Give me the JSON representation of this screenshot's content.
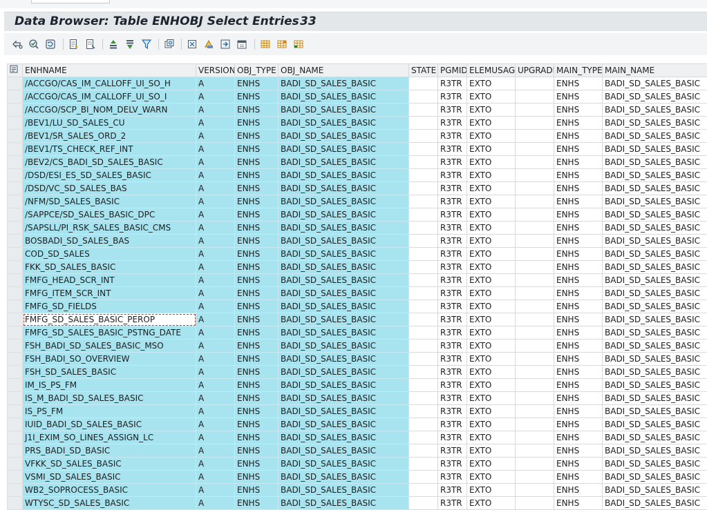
{
  "title": {
    "text": "Data Browser: Table ENHOBJ Select Entries",
    "count": "33"
  },
  "toolbar": {
    "buttons": [
      {
        "name": "display-icon"
      },
      {
        "name": "check-table-icon"
      },
      {
        "name": "refresh-icon"
      },
      {
        "name": "choose-detail-icon"
      },
      {
        "name": "print-icon"
      },
      {
        "name": "sort-ascending-icon"
      },
      {
        "name": "sort-descending-icon"
      },
      {
        "name": "filter-icon"
      },
      {
        "name": "total-icon"
      },
      {
        "name": "export-spreadsheet-icon"
      },
      {
        "name": "change-layout-icon"
      },
      {
        "name": "save-layout-icon"
      },
      {
        "name": "abc-analysis-icon"
      },
      {
        "name": "grid-view-icon"
      },
      {
        "name": "column-set-icon"
      },
      {
        "name": "column-set2-icon"
      }
    ]
  },
  "table": {
    "columns": [
      "ENHNAME",
      "VERSION",
      "OBJ_TYPE",
      "OBJ_NAME",
      "STATE",
      "PGMID",
      "ELEMUSAGE",
      "UPGRADE",
      "MAIN_TYPE",
      "MAIN_NAME"
    ],
    "focused_row": 19,
    "rows": [
      [
        "/ACCGO/CAS_IM_CALLOFF_UI_SO_H",
        "A",
        "ENHS",
        "BADI_SD_SALES_BASIC",
        "",
        "R3TR",
        "EXTO",
        "",
        "ENHS",
        "BADI_SD_SALES_BASIC"
      ],
      [
        "/ACCGO/CAS_IM_CALLOFF_UI_SO_I",
        "A",
        "ENHS",
        "BADI_SD_SALES_BASIC",
        "",
        "R3TR",
        "EXTO",
        "",
        "ENHS",
        "BADI_SD_SALES_BASIC"
      ],
      [
        "/ACCGO/SCP_BI_NOM_DELV_WARN",
        "A",
        "ENHS",
        "BADI_SD_SALES_BASIC",
        "",
        "R3TR",
        "EXTO",
        "",
        "ENHS",
        "BADI_SD_SALES_BASIC"
      ],
      [
        "/BEV1/LU_SD_SALES_CU",
        "A",
        "ENHS",
        "BADI_SD_SALES_BASIC",
        "",
        "R3TR",
        "EXTO",
        "",
        "ENHS",
        "BADI_SD_SALES_BASIC"
      ],
      [
        "/BEV1/SR_SALES_ORD_2",
        "A",
        "ENHS",
        "BADI_SD_SALES_BASIC",
        "",
        "R3TR",
        "EXTO",
        "",
        "ENHS",
        "BADI_SD_SALES_BASIC"
      ],
      [
        "/BEV1/TS_CHECK_REF_INT",
        "A",
        "ENHS",
        "BADI_SD_SALES_BASIC",
        "",
        "R3TR",
        "EXTO",
        "",
        "ENHS",
        "BADI_SD_SALES_BASIC"
      ],
      [
        "/BEV2/CS_BADI_SD_SALES_BASIC",
        "A",
        "ENHS",
        "BADI_SD_SALES_BASIC",
        "",
        "R3TR",
        "EXTO",
        "",
        "ENHS",
        "BADI_SD_SALES_BASIC"
      ],
      [
        "/DSD/ESI_ES_SD_SALES_BASIC",
        "A",
        "ENHS",
        "BADI_SD_SALES_BASIC",
        "",
        "R3TR",
        "EXTO",
        "",
        "ENHS",
        "BADI_SD_SALES_BASIC"
      ],
      [
        "/DSD/VC_SD_SALES_BAS",
        "A",
        "ENHS",
        "BADI_SD_SALES_BASIC",
        "",
        "R3TR",
        "EXTO",
        "",
        "ENHS",
        "BADI_SD_SALES_BASIC"
      ],
      [
        "/NFM/SD_SALES_BASIC",
        "A",
        "ENHS",
        "BADI_SD_SALES_BASIC",
        "",
        "R3TR",
        "EXTO",
        "",
        "ENHS",
        "BADI_SD_SALES_BASIC"
      ],
      [
        "/SAPPCE/SD_SALES_BASIC_DPC",
        "A",
        "ENHS",
        "BADI_SD_SALES_BASIC",
        "",
        "R3TR",
        "EXTO",
        "",
        "ENHS",
        "BADI_SD_SALES_BASIC"
      ],
      [
        "/SAPSLL/PI_RSK_SALES_BASIC_CMS",
        "A",
        "ENHS",
        "BADI_SD_SALES_BASIC",
        "",
        "R3TR",
        "EXTO",
        "",
        "ENHS",
        "BADI_SD_SALES_BASIC"
      ],
      [
        "BOSBADI_SD_SALES_BAS",
        "A",
        "ENHS",
        "BADI_SD_SALES_BASIC",
        "",
        "R3TR",
        "EXTO",
        "",
        "ENHS",
        "BADI_SD_SALES_BASIC"
      ],
      [
        "COD_SD_SALES",
        "A",
        "ENHS",
        "BADI_SD_SALES_BASIC",
        "",
        "R3TR",
        "EXTO",
        "",
        "ENHS",
        "BADI_SD_SALES_BASIC"
      ],
      [
        "FKK_SD_SALES_BASIC",
        "A",
        "ENHS",
        "BADI_SD_SALES_BASIC",
        "",
        "R3TR",
        "EXTO",
        "",
        "ENHS",
        "BADI_SD_SALES_BASIC"
      ],
      [
        "FMFG_HEAD_SCR_INT",
        "A",
        "ENHS",
        "BADI_SD_SALES_BASIC",
        "",
        "R3TR",
        "EXTO",
        "",
        "ENHS",
        "BADI_SD_SALES_BASIC"
      ],
      [
        "FMFG_ITEM_SCR_INT",
        "A",
        "ENHS",
        "BADI_SD_SALES_BASIC",
        "",
        "R3TR",
        "EXTO",
        "",
        "ENHS",
        "BADI_SD_SALES_BASIC"
      ],
      [
        "FMFG_SD_FIELDS",
        "A",
        "ENHS",
        "BADI_SD_SALES_BASIC",
        "",
        "R3TR",
        "EXTO",
        "",
        "ENHS",
        "BADI_SD_SALES_BASIC"
      ],
      [
        "FMFG_SD_SALES_BASIC_PEROP",
        "A",
        "ENHS",
        "BADI_SD_SALES_BASIC",
        "",
        "R3TR",
        "EXTO",
        "",
        "ENHS",
        "BADI_SD_SALES_BASIC"
      ],
      [
        "FMFG_SD_SALES_BASIC_PSTNG_DATE",
        "A",
        "ENHS",
        "BADI_SD_SALES_BASIC",
        "",
        "R3TR",
        "EXTO",
        "",
        "ENHS",
        "BADI_SD_SALES_BASIC"
      ],
      [
        "FSH_BADI_SD_SALES_BASIC_MSO",
        "A",
        "ENHS",
        "BADI_SD_SALES_BASIC",
        "",
        "R3TR",
        "EXTO",
        "",
        "ENHS",
        "BADI_SD_SALES_BASIC"
      ],
      [
        "FSH_BADI_SO_OVERVIEW",
        "A",
        "ENHS",
        "BADI_SD_SALES_BASIC",
        "",
        "R3TR",
        "EXTO",
        "",
        "ENHS",
        "BADI_SD_SALES_BASIC"
      ],
      [
        "FSH_SD_SALES_BASIC",
        "A",
        "ENHS",
        "BADI_SD_SALES_BASIC",
        "",
        "R3TR",
        "EXTO",
        "",
        "ENHS",
        "BADI_SD_SALES_BASIC"
      ],
      [
        "IM_IS_PS_FM",
        "A",
        "ENHS",
        "BADI_SD_SALES_BASIC",
        "",
        "R3TR",
        "EXTO",
        "",
        "ENHS",
        "BADI_SD_SALES_BASIC"
      ],
      [
        "IS_M_BADI_SD_SALES_BASIC",
        "A",
        "ENHS",
        "BADI_SD_SALES_BASIC",
        "",
        "R3TR",
        "EXTO",
        "",
        "ENHS",
        "BADI_SD_SALES_BASIC"
      ],
      [
        "IS_PS_FM",
        "A",
        "ENHS",
        "BADI_SD_SALES_BASIC",
        "",
        "R3TR",
        "EXTO",
        "",
        "ENHS",
        "BADI_SD_SALES_BASIC"
      ],
      [
        "IUID_BADI_SD_SALES_BASIC",
        "A",
        "ENHS",
        "BADI_SD_SALES_BASIC",
        "",
        "R3TR",
        "EXTO",
        "",
        "ENHS",
        "BADI_SD_SALES_BASIC"
      ],
      [
        "J1I_EXIM_SO_LINES_ASSIGN_LC",
        "A",
        "ENHS",
        "BADI_SD_SALES_BASIC",
        "",
        "R3TR",
        "EXTO",
        "",
        "ENHS",
        "BADI_SD_SALES_BASIC"
      ],
      [
        "PRS_BADI_SD_BASIC",
        "A",
        "ENHS",
        "BADI_SD_SALES_BASIC",
        "",
        "R3TR",
        "EXTO",
        "",
        "ENHS",
        "BADI_SD_SALES_BASIC"
      ],
      [
        "VFKK_SD_SALES_BASIC",
        "A",
        "ENHS",
        "BADI_SD_SALES_BASIC",
        "",
        "R3TR",
        "EXTO",
        "",
        "ENHS",
        "BADI_SD_SALES_BASIC"
      ],
      [
        "VSMI_SD_SALES_BASIC",
        "A",
        "ENHS",
        "BADI_SD_SALES_BASIC",
        "",
        "R3TR",
        "EXTO",
        "",
        "ENHS",
        "BADI_SD_SALES_BASIC"
      ],
      [
        "WB2_SOPROCESS_BASIC",
        "A",
        "ENHS",
        "BADI_SD_SALES_BASIC",
        "",
        "R3TR",
        "EXTO",
        "",
        "ENHS",
        "BADI_SD_SALES_BASIC"
      ],
      [
        "WTYSC_SD_SALES_BASIC",
        "A",
        "ENHS",
        "BADI_SD_SALES_BASIC",
        "",
        "R3TR",
        "EXTO",
        "",
        "ENHS",
        "BADI_SD_SALES_BASIC"
      ]
    ]
  }
}
